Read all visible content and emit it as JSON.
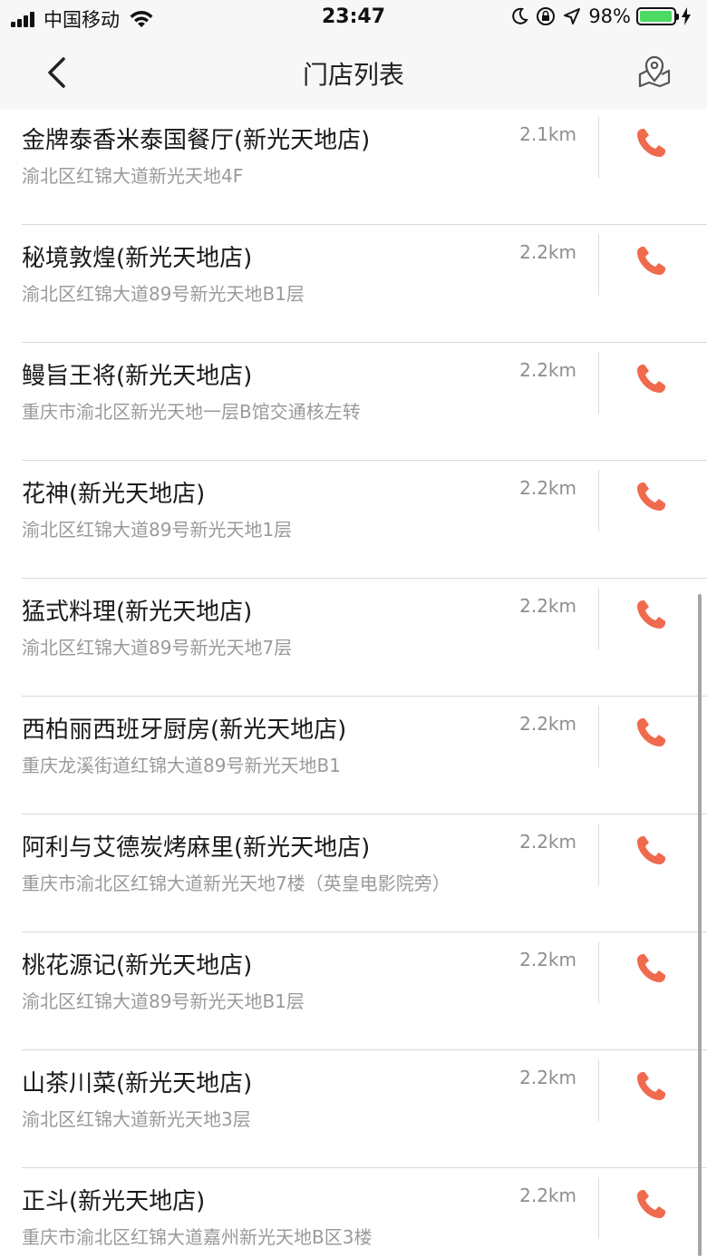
{
  "status_bar": {
    "carrier": "中国移动",
    "time": "23:47",
    "battery_percent": "98%",
    "battery_level": 0.98,
    "icons": [
      "signal-icon",
      "wifi-icon",
      "moon-icon",
      "rotation-lock-icon",
      "location-arrow-icon",
      "battery-icon",
      "charging-icon"
    ]
  },
  "nav": {
    "title": "门店列表",
    "back_icon": "chevron-left-icon",
    "map_icon": "map-pin-icon"
  },
  "colors": {
    "phone": "#f06a4e",
    "divider": "#d9d9d9",
    "nav_bg": "#f7f7f7"
  },
  "stores": [
    {
      "name": "金牌泰香米泰国餐厅(新光天地店)",
      "address": "渝北区红锦大道新光天地4F",
      "distance": "2.1km"
    },
    {
      "name": "秘境敦煌(新光天地店)",
      "address": "渝北区红锦大道89号新光天地B1层",
      "distance": "2.2km"
    },
    {
      "name": "鳗旨王将(新光天地店)",
      "address": "重庆市渝北区新光天地一层B馆交通核左转",
      "distance": "2.2km"
    },
    {
      "name": "花神(新光天地店)",
      "address": "渝北区红锦大道89号新光天地1层",
      "distance": "2.2km"
    },
    {
      "name": "猛式料理(新光天地店)",
      "address": "渝北区红锦大道89号新光天地7层",
      "distance": "2.2km"
    },
    {
      "name": "西柏丽西班牙厨房(新光天地店)",
      "address": "重庆龙溪街道红锦大道89号新光天地B1",
      "distance": "2.2km"
    },
    {
      "name": "阿利与艾德炭烤麻里(新光天地店)",
      "address": "重庆市渝北区红锦大道新光天地7楼（英皇电影院旁）",
      "distance": "2.2km"
    },
    {
      "name": "桃花源记(新光天地店)",
      "address": "渝北区红锦大道89号新光天地B1层",
      "distance": "2.2km"
    },
    {
      "name": "山茶川菜(新光天地店)",
      "address": "渝北区红锦大道新光天地3层",
      "distance": "2.2km"
    },
    {
      "name": "正斗(新光天地店)",
      "address": "重庆市渝北区红锦大道嘉州新光天地B区3楼",
      "distance": "2.2km"
    }
  ]
}
